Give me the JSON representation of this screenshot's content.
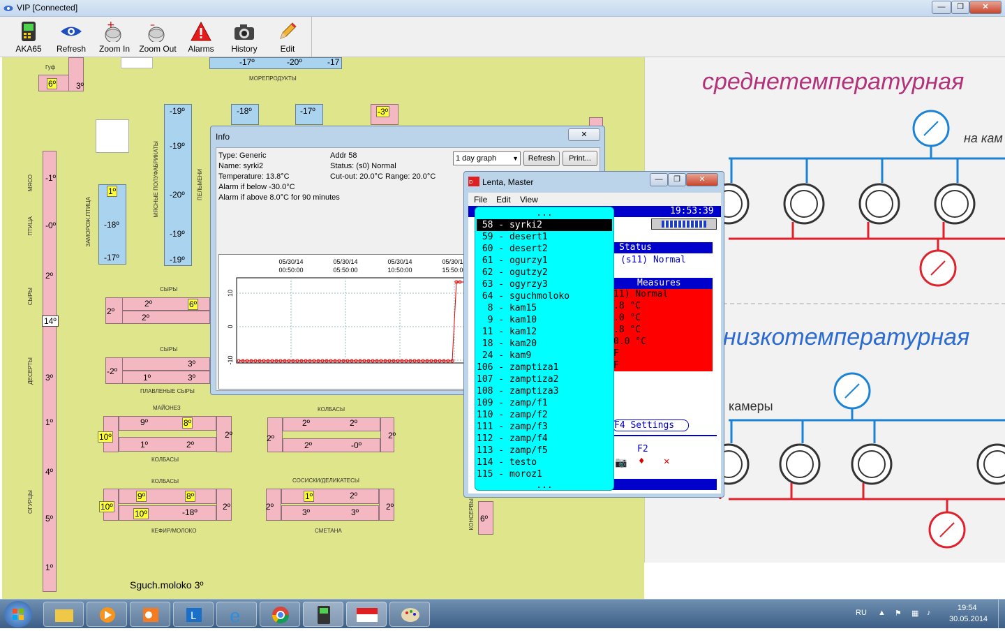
{
  "window": {
    "title": "VIP [Connected]"
  },
  "toolbar": [
    {
      "label": "AKA65",
      "icon": "aka65-device-icon"
    },
    {
      "label": "Refresh",
      "icon": "eye-refresh-icon"
    },
    {
      "label": "Zoom In",
      "icon": "zoom-in-icon"
    },
    {
      "label": "Zoom Out",
      "icon": "zoom-out-icon"
    },
    {
      "label": "Alarms",
      "icon": "alarm-warning-icon"
    },
    {
      "label": "History",
      "icon": "camera-history-icon"
    },
    {
      "label": "Edit",
      "icon": "pencil-edit-icon"
    }
  ],
  "floor": {
    "labels": {
      "guf": "Гуф",
      "moreprod": "МОРЕПРОДУКТЫ",
      "myaso": "МЯСО",
      "ptitsa": "ПТИЦА",
      "syry_v": "СЫРЫ",
      "deserty": "ДЕСЕРТЫ",
      "ovoshchi": "ОГУРЦЫ",
      "zamorozh": "ЗАМОРОЖ.ПТИЦА",
      "myasn_polufab": "МЯСНЫЕ ПОЛУФАБРИКАТЫ",
      "pelmeni": "ПЕЛЬМЕНИ",
      "syry1": "СЫРЫ",
      "syry2": "СЫРЫ",
      "plavl_syry": "ПЛАВЛЕНЫЕ СЫРЫ",
      "maionez": "МАЙОНЕЗ",
      "kolbasy1": "КОЛБАСЫ",
      "kolbasy2": "КОЛБАСЫ",
      "kolbasy3": "КОЛБАСЫ",
      "sosiski": "СОСИСКИ/ДЕЛИКАТЕСЫ",
      "kefir": "КЕФИР/МОЛОКО",
      "smetana": "СМЕТАНА",
      "konservy": "КОНСЕРВЫ",
      "sguch": "Sguch.moloko 3º"
    },
    "temps": {
      "guf_a": "6º",
      "guf_b": "3º",
      "top1": "-17º",
      "top2": "-20º",
      "top3": "-17",
      "b1": "-19º",
      "b2": "-19º",
      "b3": "-20º",
      "b4": "-19º",
      "b5": "-19º",
      "c1": "-18º",
      "c2": "-17º",
      "c3": "-3º",
      "z1": "1º",
      "z2": "-18º",
      "z3": "-17º",
      "v1": "-1º",
      "v2": "-0º",
      "v3": "2º",
      "v4": "14º",
      "v5": "3º",
      "v6": "1º",
      "v7": "4º",
      "v8": "5º",
      "v9": "1º",
      "s1a": "2º",
      "s1b": "6º",
      "s1c": "2º",
      "s1d": "2º",
      "s2a": "3º",
      "s2b": "1º",
      "s2c": "3º",
      "s2d": "-2º",
      "m1": "9º",
      "m2": "8º",
      "m3": "1º",
      "m4": "2º",
      "m5": "10º",
      "m6": "2º",
      "k1": "2º",
      "k2": "2º",
      "k3": "2º",
      "k4": "-0º",
      "k5": "2º",
      "k6": "2º",
      "kf1": "9º",
      "kf2": "8º",
      "kf3": "10º",
      "kf4": "-18º",
      "kf5": "10º",
      "kf6": "2º",
      "sm1": "1º",
      "sm2": "2º",
      "sm3": "3º",
      "sm4": "3º",
      "sm5": "2º",
      "sm6": "2º",
      "kons": "6º"
    }
  },
  "schema": {
    "medium_title": "среднетемпературная",
    "low_title": "низкотемпературная",
    "na_kam": "на кам",
    "kamery": "камеры"
  },
  "info": {
    "title": "Info",
    "type": "Type: Generic",
    "addr": "Addr 58",
    "name": "Name: syrki2",
    "status": "Status: (s0) Normal",
    "temperature": "Temperature:    13.8°C",
    "cutout": "Cut-out: 20.0°C  Range: 20.0°C",
    "alarm_below": "Alarm if below  -30.0°C",
    "alarm_above": "Alarm if above   8.0°C for 90 minutes",
    "graph_select": "1 day graph",
    "refresh_label": "Refresh",
    "print_label": "Print...",
    "close_label": "✕"
  },
  "chart_data": {
    "type": "line",
    "x_ticks": [
      [
        "05/30/14",
        "00:50:00"
      ],
      [
        "05/30/14",
        "05:50:00"
      ],
      [
        "05/30/14",
        "10:50:00"
      ],
      [
        "05/30/14",
        "15:50:00"
      ]
    ],
    "y_ticks": [
      "10",
      "0",
      "-10"
    ],
    "series": [
      {
        "values_note": "flat near -15 then jump to ~13"
      }
    ]
  },
  "lenta": {
    "title": "Lenta, Master",
    "menu": [
      "File",
      "Edit",
      "View"
    ],
    "clock": "19:53:39",
    "status_hdr": "Status",
    "status_val": "(s11) Normal",
    "measures_hdr": "Measures",
    "measures": [
      "11) Normal",
      ".8 °C",
      ".0 °C",
      ".8 °C",
      "0.0 °C",
      "F",
      "F"
    ],
    "settings": "F4 Settings",
    "f2": "F2",
    "ellipsis": "...",
    "nodes": [
      " 58 - syrki2",
      " 59 - desert1",
      " 60 - desert2",
      " 61 - ogurzy1",
      " 62 - ogutzy2",
      " 63 - ogyrzy3",
      " 64 - sguchmoloko",
      "  8 - kam15",
      "  9 - kam10",
      " 11 - kam12",
      " 18 - kam20",
      " 24 - kam9",
      "106 - zamptiza1",
      "107 - zamptiza2",
      "108 - zamptiza3",
      "109 - zamp/f1",
      "110 - zamp/f2",
      "111 - zamp/f3",
      "112 - zamp/f4",
      "113 - zamp/f5",
      "114 - testo",
      "115 - moroz1"
    ]
  },
  "taskbar": {
    "lang": "RU",
    "time": "19:54",
    "date": "30.05.2014"
  }
}
